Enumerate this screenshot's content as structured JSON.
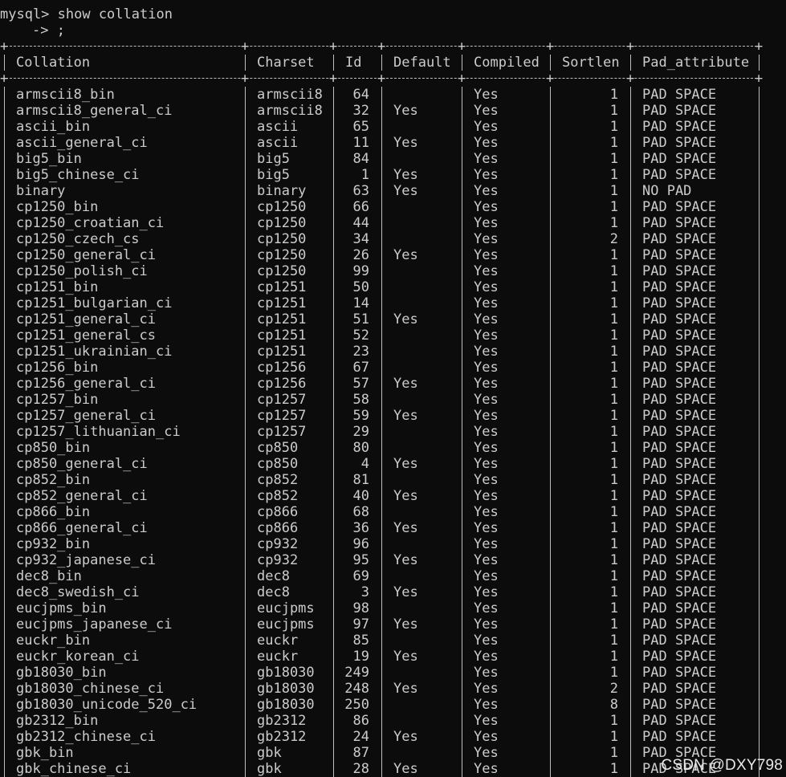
{
  "terminal": {
    "prompt_line": "mysql> show collation",
    "continuation_line": "-> ;"
  },
  "table": {
    "headers": [
      "Collation",
      "Charset",
      "Id",
      "Default",
      "Compiled",
      "Sortlen",
      "Pad_attribute"
    ],
    "rows": [
      [
        "armscii8_bin",
        "armscii8",
        "64",
        "",
        "Yes",
        "1",
        "PAD SPACE"
      ],
      [
        "armscii8_general_ci",
        "armscii8",
        "32",
        "Yes",
        "Yes",
        "1",
        "PAD SPACE"
      ],
      [
        "ascii_bin",
        "ascii",
        "65",
        "",
        "Yes",
        "1",
        "PAD SPACE"
      ],
      [
        "ascii_general_ci",
        "ascii",
        "11",
        "Yes",
        "Yes",
        "1",
        "PAD SPACE"
      ],
      [
        "big5_bin",
        "big5",
        "84",
        "",
        "Yes",
        "1",
        "PAD SPACE"
      ],
      [
        "big5_chinese_ci",
        "big5",
        "1",
        "Yes",
        "Yes",
        "1",
        "PAD SPACE"
      ],
      [
        "binary",
        "binary",
        "63",
        "Yes",
        "Yes",
        "1",
        "NO PAD"
      ],
      [
        "cp1250_bin",
        "cp1250",
        "66",
        "",
        "Yes",
        "1",
        "PAD SPACE"
      ],
      [
        "cp1250_croatian_ci",
        "cp1250",
        "44",
        "",
        "Yes",
        "1",
        "PAD SPACE"
      ],
      [
        "cp1250_czech_cs",
        "cp1250",
        "34",
        "",
        "Yes",
        "2",
        "PAD SPACE"
      ],
      [
        "cp1250_general_ci",
        "cp1250",
        "26",
        "Yes",
        "Yes",
        "1",
        "PAD SPACE"
      ],
      [
        "cp1250_polish_ci",
        "cp1250",
        "99",
        "",
        "Yes",
        "1",
        "PAD SPACE"
      ],
      [
        "cp1251_bin",
        "cp1251",
        "50",
        "",
        "Yes",
        "1",
        "PAD SPACE"
      ],
      [
        "cp1251_bulgarian_ci",
        "cp1251",
        "14",
        "",
        "Yes",
        "1",
        "PAD SPACE"
      ],
      [
        "cp1251_general_ci",
        "cp1251",
        "51",
        "Yes",
        "Yes",
        "1",
        "PAD SPACE"
      ],
      [
        "cp1251_general_cs",
        "cp1251",
        "52",
        "",
        "Yes",
        "1",
        "PAD SPACE"
      ],
      [
        "cp1251_ukrainian_ci",
        "cp1251",
        "23",
        "",
        "Yes",
        "1",
        "PAD SPACE"
      ],
      [
        "cp1256_bin",
        "cp1256",
        "67",
        "",
        "Yes",
        "1",
        "PAD SPACE"
      ],
      [
        "cp1256_general_ci",
        "cp1256",
        "57",
        "Yes",
        "Yes",
        "1",
        "PAD SPACE"
      ],
      [
        "cp1257_bin",
        "cp1257",
        "58",
        "",
        "Yes",
        "1",
        "PAD SPACE"
      ],
      [
        "cp1257_general_ci",
        "cp1257",
        "59",
        "Yes",
        "Yes",
        "1",
        "PAD SPACE"
      ],
      [
        "cp1257_lithuanian_ci",
        "cp1257",
        "29",
        "",
        "Yes",
        "1",
        "PAD SPACE"
      ],
      [
        "cp850_bin",
        "cp850",
        "80",
        "",
        "Yes",
        "1",
        "PAD SPACE"
      ],
      [
        "cp850_general_ci",
        "cp850",
        "4",
        "Yes",
        "Yes",
        "1",
        "PAD SPACE"
      ],
      [
        "cp852_bin",
        "cp852",
        "81",
        "",
        "Yes",
        "1",
        "PAD SPACE"
      ],
      [
        "cp852_general_ci",
        "cp852",
        "40",
        "Yes",
        "Yes",
        "1",
        "PAD SPACE"
      ],
      [
        "cp866_bin",
        "cp866",
        "68",
        "",
        "Yes",
        "1",
        "PAD SPACE"
      ],
      [
        "cp866_general_ci",
        "cp866",
        "36",
        "Yes",
        "Yes",
        "1",
        "PAD SPACE"
      ],
      [
        "cp932_bin",
        "cp932",
        "96",
        "",
        "Yes",
        "1",
        "PAD SPACE"
      ],
      [
        "cp932_japanese_ci",
        "cp932",
        "95",
        "Yes",
        "Yes",
        "1",
        "PAD SPACE"
      ],
      [
        "dec8_bin",
        "dec8",
        "69",
        "",
        "Yes",
        "1",
        "PAD SPACE"
      ],
      [
        "dec8_swedish_ci",
        "dec8",
        "3",
        "Yes",
        "Yes",
        "1",
        "PAD SPACE"
      ],
      [
        "eucjpms_bin",
        "eucjpms",
        "98",
        "",
        "Yes",
        "1",
        "PAD SPACE"
      ],
      [
        "eucjpms_japanese_ci",
        "eucjpms",
        "97",
        "Yes",
        "Yes",
        "1",
        "PAD SPACE"
      ],
      [
        "euckr_bin",
        "euckr",
        "85",
        "",
        "Yes",
        "1",
        "PAD SPACE"
      ],
      [
        "euckr_korean_ci",
        "euckr",
        "19",
        "Yes",
        "Yes",
        "1",
        "PAD SPACE"
      ],
      [
        "gb18030_bin",
        "gb18030",
        "249",
        "",
        "Yes",
        "1",
        "PAD SPACE"
      ],
      [
        "gb18030_chinese_ci",
        "gb18030",
        "248",
        "Yes",
        "Yes",
        "2",
        "PAD SPACE"
      ],
      [
        "gb18030_unicode_520_ci",
        "gb18030",
        "250",
        "",
        "Yes",
        "8",
        "PAD SPACE"
      ],
      [
        "gb2312_bin",
        "gb2312",
        "86",
        "",
        "Yes",
        "1",
        "PAD SPACE"
      ],
      [
        "gb2312_chinese_ci",
        "gb2312",
        "24",
        "Yes",
        "Yes",
        "1",
        "PAD SPACE"
      ],
      [
        "gbk_bin",
        "gbk",
        "87",
        "",
        "Yes",
        "1",
        "PAD SPACE"
      ],
      [
        "gbk_chinese_ci",
        "gbk",
        "28",
        "Yes",
        "Yes",
        "1",
        "PAD SPACE"
      ]
    ]
  },
  "watermark": "CSDN @DXY798",
  "colors": {
    "background": "#0c0c0c",
    "text": "#cccccc"
  }
}
